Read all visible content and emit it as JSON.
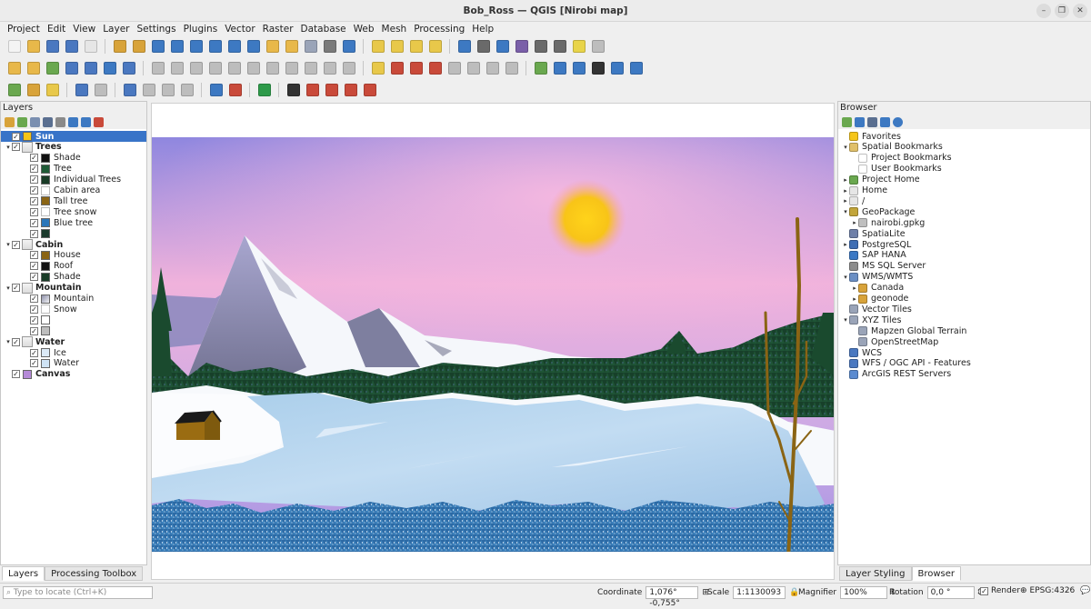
{
  "window": {
    "title": "Bob_Ross — QGIS [Nirobi map]"
  },
  "menu": [
    "Project",
    "Edit",
    "View",
    "Layer",
    "Settings",
    "Plugins",
    "Vector",
    "Raster",
    "Database",
    "Web",
    "Mesh",
    "Processing",
    "Help"
  ],
  "layers_panel": {
    "title": "Layers",
    "items": [
      {
        "label": "Sun",
        "checked": true,
        "bold": true,
        "level": 0,
        "group": false,
        "selected": true,
        "color": "#f5c518"
      },
      {
        "label": "Trees",
        "checked": true,
        "bold": true,
        "level": 0,
        "group": true
      },
      {
        "label": "Shade",
        "checked": true,
        "level": 1,
        "color": "#111111"
      },
      {
        "label": "Tree",
        "checked": true,
        "level": 1,
        "color": "#1f5a36"
      },
      {
        "label": "Individual Trees",
        "checked": true,
        "level": 1,
        "color": "#183b26"
      },
      {
        "label": "Cabin area",
        "checked": true,
        "level": 1,
        "color": ""
      },
      {
        "label": "Tall tree",
        "checked": true,
        "level": 1,
        "color": "#8a6414"
      },
      {
        "label": "Tree snow",
        "checked": true,
        "level": 1,
        "color": ""
      },
      {
        "label": "Blue tree",
        "checked": true,
        "level": 1,
        "color": "#2b76b9"
      },
      {
        "label": "",
        "checked": true,
        "level": 1,
        "color": "#1b3a2c"
      },
      {
        "label": "Cabin",
        "checked": true,
        "bold": true,
        "level": 0,
        "group": true
      },
      {
        "label": "House",
        "checked": true,
        "level": 1,
        "color": "#8a6414"
      },
      {
        "label": "Roof",
        "checked": true,
        "level": 1,
        "color": "#111111"
      },
      {
        "label": "Shade",
        "checked": true,
        "level": 1,
        "color": "#183b26"
      },
      {
        "label": "Mountain",
        "checked": true,
        "bold": true,
        "level": 0,
        "group": true
      },
      {
        "label": "Mountain",
        "checked": true,
        "level": 1,
        "color": "#c8ccd6"
      },
      {
        "label": "Snow",
        "checked": true,
        "level": 1,
        "color": ""
      },
      {
        "label": "",
        "checked": true,
        "level": 1,
        "color": ""
      },
      {
        "label": "",
        "checked": true,
        "level": 1,
        "color": "#bdbdbd"
      },
      {
        "label": "Water",
        "checked": true,
        "bold": true,
        "level": 0,
        "group": true
      },
      {
        "label": "Ice",
        "checked": true,
        "level": 1,
        "color": "#dbe9f6"
      },
      {
        "label": "Water",
        "checked": true,
        "level": 1,
        "color": "#cfe3f5"
      },
      {
        "label": "Canvas",
        "checked": true,
        "bold": true,
        "level": 0,
        "group": false,
        "color": "#b58ad8"
      }
    ],
    "tabs": [
      "Layers",
      "Processing Toolbox"
    ]
  },
  "browser_panel": {
    "title": "Browser",
    "items": [
      {
        "label": "Favorites",
        "level": 0,
        "arrow": "",
        "icon": "#f5c518"
      },
      {
        "label": "Spatial Bookmarks",
        "level": 0,
        "arrow": "▾",
        "icon": "#e0c06a"
      },
      {
        "label": "Project Bookmarks",
        "level": 1,
        "arrow": "",
        "icon": "#ffffff"
      },
      {
        "label": "User Bookmarks",
        "level": 1,
        "arrow": "",
        "icon": "#ffffff"
      },
      {
        "label": "Project Home",
        "level": 0,
        "arrow": "▸",
        "icon": "#6aa84f"
      },
      {
        "label": "Home",
        "level": 0,
        "arrow": "▸",
        "icon": "#e6e6e6"
      },
      {
        "label": "/",
        "level": 0,
        "arrow": "▸",
        "icon": "#e6e6e6"
      },
      {
        "label": "GeoPackage",
        "level": 0,
        "arrow": "▾",
        "icon": "#c2a53a"
      },
      {
        "label": "nairobi.gpkg",
        "level": 1,
        "arrow": "▸",
        "icon": "#bfbfbf"
      },
      {
        "label": "SpatiaLite",
        "level": 0,
        "arrow": "",
        "icon": "#6e7fa8"
      },
      {
        "label": "PostgreSQL",
        "level": 0,
        "arrow": "▸",
        "icon": "#3f6eb4"
      },
      {
        "label": "SAP HANA",
        "level": 0,
        "arrow": "",
        "icon": "#3a78c4"
      },
      {
        "label": "MS SQL Server",
        "level": 0,
        "arrow": "",
        "icon": "#8c8c8c"
      },
      {
        "label": "WMS/WMTS",
        "level": 0,
        "arrow": "▾",
        "icon": "#6b8fc4"
      },
      {
        "label": "Canada",
        "level": 1,
        "arrow": "▸",
        "icon": "#d8a33a"
      },
      {
        "label": "geonode",
        "level": 1,
        "arrow": "▸",
        "icon": "#d8a33a"
      },
      {
        "label": "Vector Tiles",
        "level": 0,
        "arrow": "",
        "icon": "#9aa4b8"
      },
      {
        "label": "XYZ Tiles",
        "level": 0,
        "arrow": "▾",
        "icon": "#9aa4b8"
      },
      {
        "label": "Mapzen Global Terrain",
        "level": 1,
        "arrow": "",
        "icon": "#9aa4b8"
      },
      {
        "label": "OpenStreetMap",
        "level": 1,
        "arrow": "",
        "icon": "#9aa4b8"
      },
      {
        "label": "WCS",
        "level": 0,
        "arrow": "",
        "icon": "#4a78c0"
      },
      {
        "label": "WFS / OGC API - Features",
        "level": 0,
        "arrow": "",
        "icon": "#4a78c0"
      },
      {
        "label": "ArcGIS REST Servers",
        "level": 0,
        "arrow": "",
        "icon": "#5b8bd0"
      }
    ],
    "tabs": [
      "Layer Styling",
      "Browser"
    ]
  },
  "statusbar": {
    "locator_placeholder": "Type to locate (Ctrl+K)",
    "coordinate_label": "Coordinate",
    "coordinate_value": "1,076° -0,755°",
    "scale_label": "Scale",
    "scale_value": "1:1130093",
    "magnifier_label": "Magnifier",
    "magnifier_value": "100%",
    "rotation_label": "Rotation",
    "rotation_value": "0,0 °",
    "render_label": "Render",
    "crs": "EPSG:4326"
  },
  "colors": {
    "sky_top": "#9c8ee0",
    "sky_mid": "#f3b3dd",
    "sun": "#f7c819",
    "forest": "#17402a",
    "lake": "#b4d4ee",
    "blue_trees": "#2f6fa8",
    "tall_tree": "#8a6414",
    "cabin": "#9a6c12"
  }
}
